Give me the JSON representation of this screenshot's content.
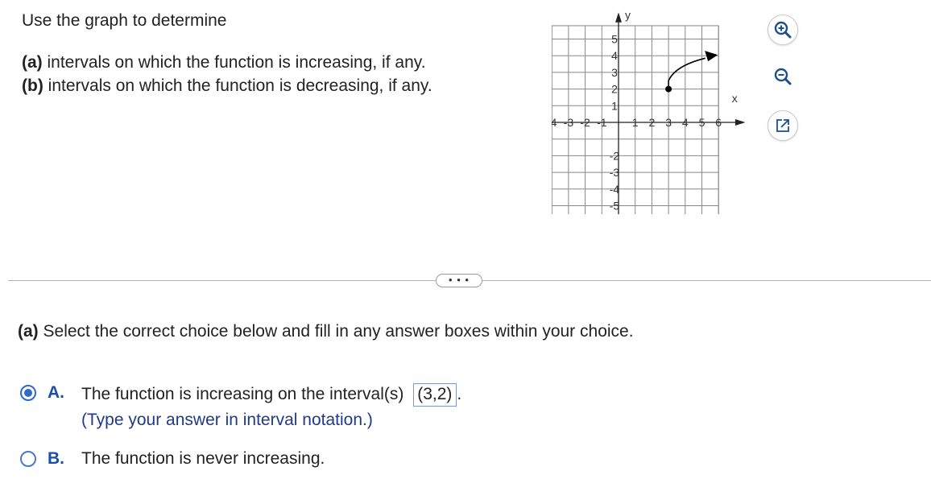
{
  "prompt": {
    "intro": "Use the graph to determine",
    "a_label": "(a)",
    "a_text": " intervals on which the function is increasing, if any.",
    "b_label": "(b)",
    "b_text": " intervals on which the function is decreasing, if any."
  },
  "graph": {
    "x_axis_label": "x",
    "y_axis_label": "y",
    "x_ticks": [
      "-4",
      "-3",
      "-2",
      "-1",
      "1",
      "2",
      "3",
      "4",
      "5",
      "6"
    ],
    "y_ticks": [
      "5",
      "4",
      "3",
      "2",
      "1",
      "-2",
      "-3",
      "-4",
      "-5"
    ],
    "curve_start_point": [
      3,
      2
    ],
    "curve_end_direction": "arrow toward upper right"
  },
  "toolbar": {
    "zoom_in": "zoom-in",
    "zoom_out": "zoom-out",
    "popout": "open-in-new-window"
  },
  "more_button": "• • •",
  "question": {
    "label": "(a)",
    "text": " Select the correct choice below and fill in any answer boxes within your choice."
  },
  "choices": {
    "a": {
      "letter": "A.",
      "text": "The function is increasing on the interval(s) ",
      "answer": "(3,2)",
      "after": ".",
      "hint": "(Type your answer in interval notation.)",
      "selected": true
    },
    "b": {
      "letter": "B.",
      "text": "The function is never increasing.",
      "selected": false
    }
  }
}
